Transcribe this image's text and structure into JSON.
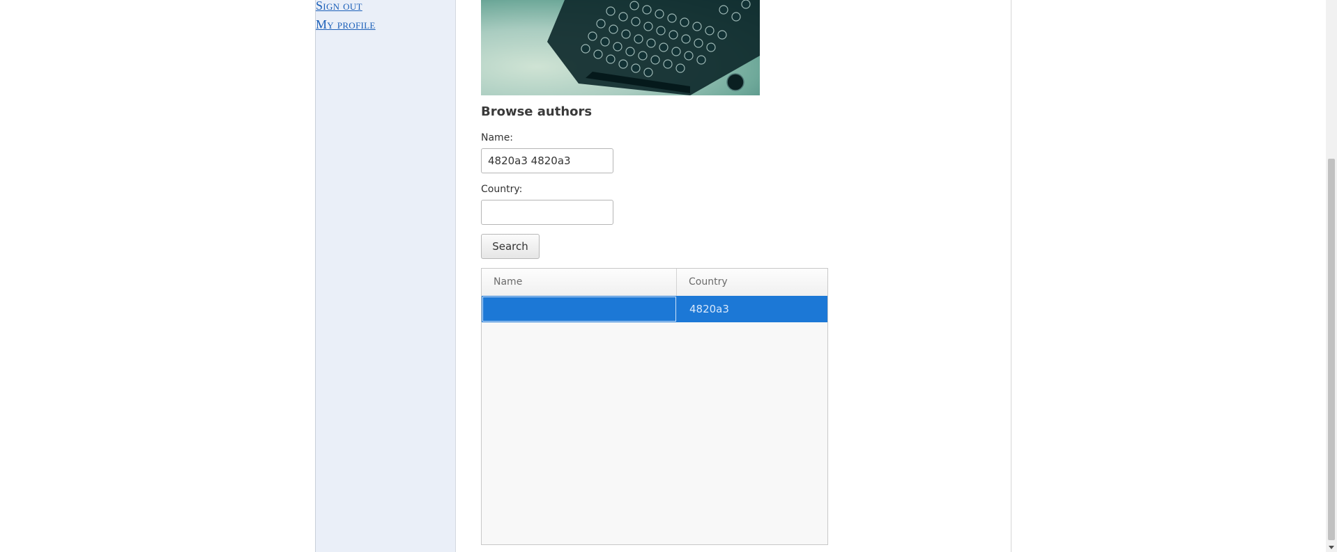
{
  "sidebar": {
    "links": [
      {
        "label": "Sign out"
      },
      {
        "label": "My profile"
      }
    ]
  },
  "hero": {
    "icon": "typewriter-image"
  },
  "browse": {
    "heading": "Browse authors",
    "name_label": "Name:",
    "name_value": "4820a3 4820a3",
    "country_label": "Country:",
    "country_value": "",
    "search_label": "Search"
  },
  "results": {
    "columns": [
      "Name",
      "Country"
    ],
    "rows": [
      {
        "name": "",
        "country": "4820a3",
        "selected": true
      }
    ]
  },
  "colors": {
    "sidebar_bg": "#eaeff8",
    "link": "#1b5fb8",
    "selected_row": "#1c78d6"
  }
}
